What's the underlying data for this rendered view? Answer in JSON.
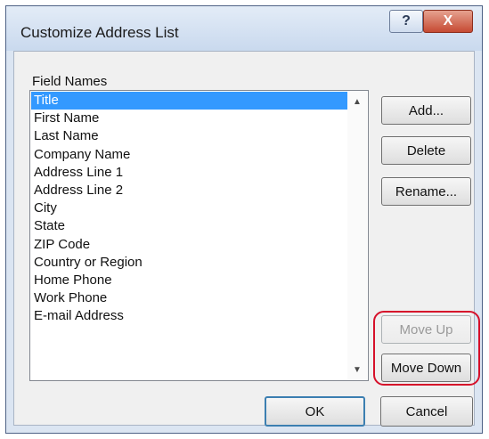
{
  "window": {
    "title": "Customize Address List",
    "help_label": "?",
    "close_label": "X"
  },
  "field_names_label": "Field Names",
  "fields": [
    "Title",
    "First Name",
    "Last Name",
    "Company Name",
    "Address Line 1",
    "Address Line 2",
    "City",
    "State",
    "ZIP Code",
    "Country or Region",
    "Home Phone",
    "Work Phone",
    "E-mail Address"
  ],
  "selected_field": "Title",
  "scrollbar": {
    "up_icon": "▲",
    "down_icon": "▼"
  },
  "buttons": {
    "add": "Add...",
    "delete": "Delete",
    "rename": "Rename...",
    "move_up": "Move Up",
    "move_down": "Move Down",
    "ok": "OK",
    "cancel": "Cancel"
  },
  "colors": {
    "selection": "#3399ff",
    "highlight_outline": "#d6102a",
    "close_button": "#c64a33"
  }
}
